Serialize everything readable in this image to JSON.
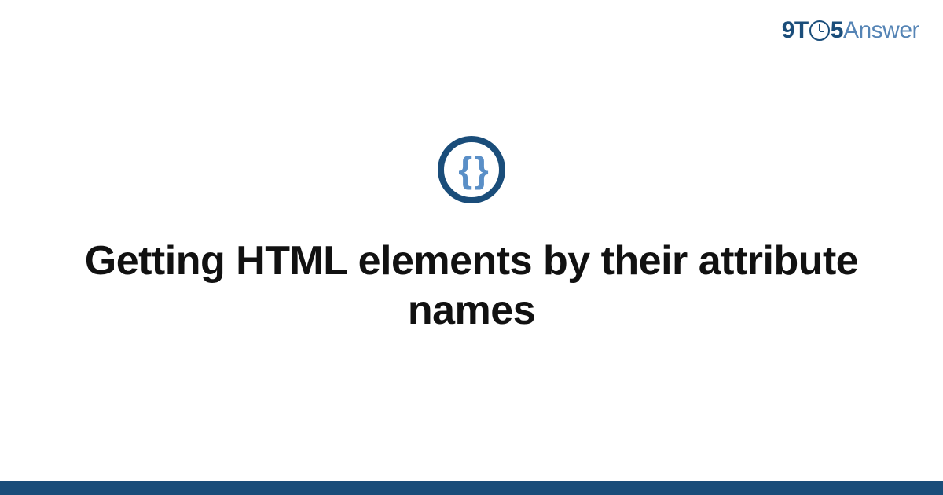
{
  "logo": {
    "part1": "9T",
    "part2": "5",
    "part3": "Answer"
  },
  "badge": {
    "symbol": "{ }"
  },
  "title": "Getting HTML elements by their attribute names",
  "colors": {
    "primary": "#1a4d7a",
    "secondary": "#5584b5",
    "accent": "#5a8fc7"
  }
}
